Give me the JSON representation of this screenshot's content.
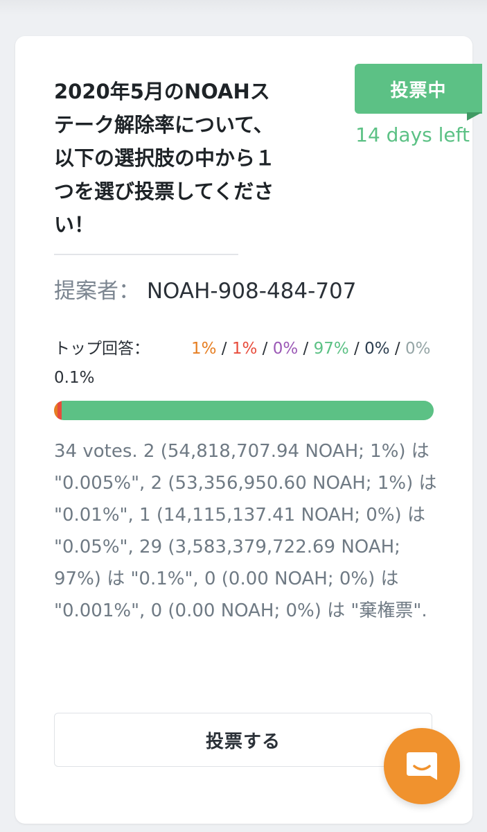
{
  "poll": {
    "title": "2020年5月のNOAHステーク解除率について、以下の選択肢の中から１つを選び投票してください！",
    "status_badge": "投票中",
    "time_left": "14 days left",
    "proposer_label": "提案者：",
    "proposer_id": "NOAH-908-484-707",
    "top_answer_label": "トップ回答：",
    "top_answer_value": "0.1%",
    "percentages": [
      {
        "label": "1%",
        "color": "#e67e22"
      },
      {
        "label": "1%",
        "color": "#e74c3c"
      },
      {
        "label": "0%",
        "color": "#9b59b6"
      },
      {
        "label": "97%",
        "color": "#5cc185"
      },
      {
        "label": "0%",
        "color": "#2c3e50"
      },
      {
        "label": "0%",
        "color": "#95a5a6"
      }
    ],
    "separator": " / ",
    "bar_segments": [
      {
        "share": 0.01,
        "color": "#e67e22"
      },
      {
        "share": 0.01,
        "color": "#e74c3c"
      },
      {
        "share": 0.0,
        "color": "#9b59b6"
      },
      {
        "share": 0.98,
        "color": "#5cc185"
      },
      {
        "share": 0.0,
        "color": "#2c3e50"
      },
      {
        "share": 0.0,
        "color": "#95a5a6"
      }
    ],
    "votes_summary": "34 votes. 2 (54,818,707.94 NOAH; 1%) は \"0.005%\", 2 (53,356,950.60 NOAH; 1%) は \"0.01%\", 1 (14,115,137.41 NOAH; 0%) は \"0.05%\", 29 (3,583,379,722.69 NOAH; 97%) は \"0.1%\", 0 (0.00 NOAH; 0%) は \"0.001%\", 0 (0.00 NOAH; 0%) は \"棄権票\".",
    "vote_button_label": "投票する"
  },
  "chat": {
    "icon": "chat-bubble-smile-icon",
    "color": "#f0922e"
  },
  "colors": {
    "accent": "#5cc185",
    "text": "#2b3138",
    "muted": "#6f7a84"
  }
}
